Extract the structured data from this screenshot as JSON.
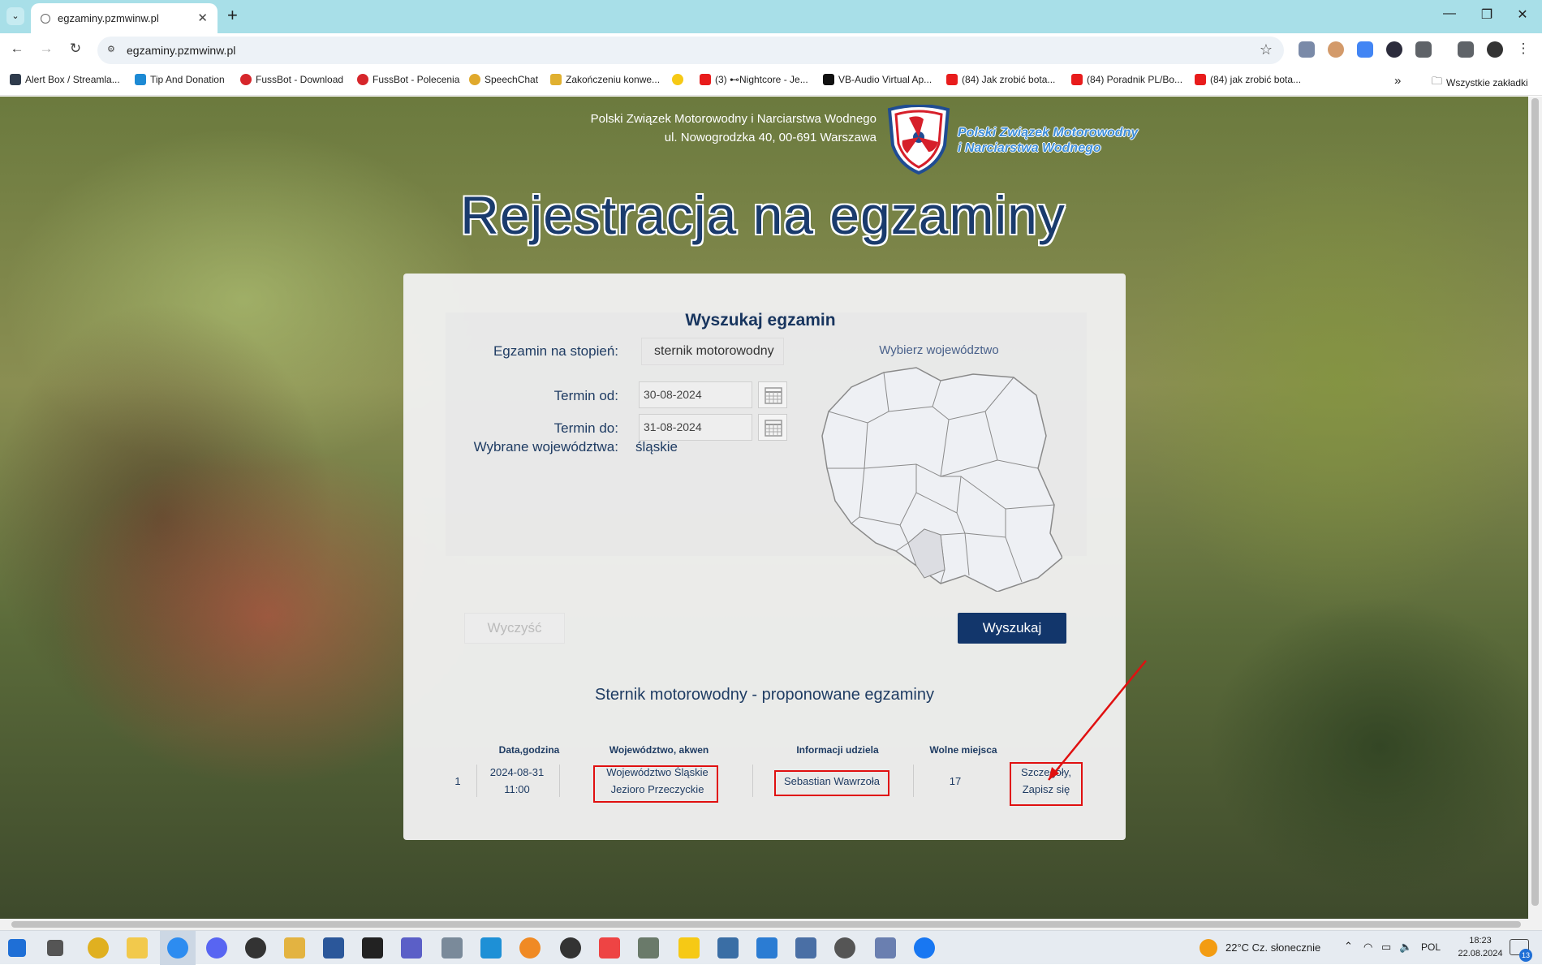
{
  "browser": {
    "tab_title": "egzaminy.pzmwinw.pl",
    "url": "egzaminy.pzmwinw.pl",
    "bookmarks": [
      {
        "label": "Alert Box / Streamla...",
        "color": "#2f3b4c"
      },
      {
        "label": "Tip And Donation",
        "color": "#1d8ad4"
      },
      {
        "label": "FussBot - Download",
        "color": "#d6262b"
      },
      {
        "label": "FussBot - Polecenia",
        "color": "#d6262b"
      },
      {
        "label": "SpeechChat",
        "color": "#e0a92c"
      },
      {
        "label": "Zakończeniu konwe...",
        "color": "#e0b030"
      },
      {
        "label": "",
        "color": "#f6c915"
      },
      {
        "label": "(3) ⊷Nightcore - Je...",
        "color": "#e81c1c"
      },
      {
        "label": "VB-Audio Virtual Ap...",
        "color": "#111111"
      },
      {
        "label": "(84) Jak zrobić bota...",
        "color": "#e81c1c"
      },
      {
        "label": "(84) Poradnik PL/Bo...",
        "color": "#e81c1c"
      },
      {
        "label": "(84) jak zrobić bota...",
        "color": "#e81c1c"
      }
    ],
    "bookmarks_more": "»",
    "all_bookmarks": "Wszystkie zakładki"
  },
  "header": {
    "org_line1": "Polski Związek Motorowodny i Narciarstwa Wodnego",
    "org_line2": "ul. Nowogrodzka 40, 00-691 Warszawa",
    "logo_line1": "Polski Związek Motorowodny",
    "logo_line2": "i Narciarstwa Wodnego",
    "page_title": "Rejestracja na egzaminy"
  },
  "form": {
    "title": "Wyszukaj egzamin",
    "stopien_label": "Egzamin na stopień:",
    "stopien_value": "sternik motorowodny",
    "od_label": "Termin od:",
    "od_value": "30-08-2024",
    "do_label": "Termin do:",
    "do_value": "31-08-2024",
    "woj_label": "Wybrane województwa:",
    "woj_value": "śląskie",
    "map_label": "Wybierz województwo",
    "clear_label": "Wyczyść",
    "search_label": "Wyszukaj"
  },
  "results": {
    "title": "Sternik motorowodny - proponowane egzaminy",
    "headers": [
      "Data,godzina",
      "Województwo, akwen",
      "Informacji udziela",
      "Wolne miejsca"
    ],
    "rows": [
      {
        "index": "1",
        "date": "2024-08-31",
        "time": "11:00",
        "region": "Województwo Śląskie",
        "lake": "Jezioro Przeczyckie",
        "contact": "Sebastian Wawrzoła",
        "free": "17",
        "action1": "Szczegóły,",
        "action2": "Zapisz się"
      }
    ]
  },
  "taskbar": {
    "weather": "22°C  Cz. słonecznie",
    "lang": "POL",
    "time": "18:23",
    "date": "22.08.2024",
    "notif": "13"
  },
  "colors": {
    "brand_dark": "#12366b",
    "highlight": "#e01010"
  }
}
